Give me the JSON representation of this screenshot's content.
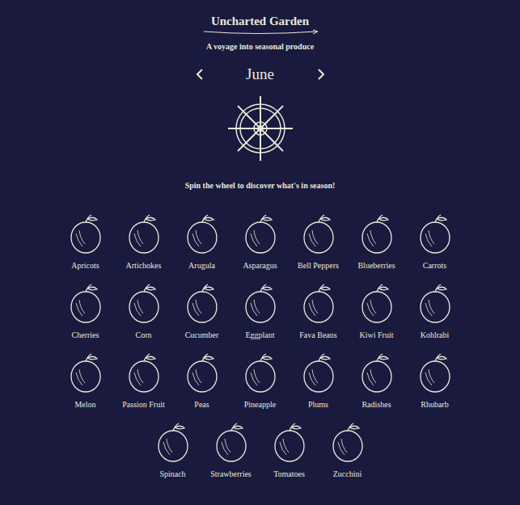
{
  "header": {
    "title": "Uncharted Garden",
    "tagline": "A voyage into seasonal produce"
  },
  "month_nav": {
    "month": "June"
  },
  "wheel": {
    "cue": "Spin the wheel to discover what's in season!"
  },
  "produce": [
    "Apricots",
    "Artichokes",
    "Arugula",
    "Asparagus",
    "Bell Peppers",
    "Blueberries",
    "Carrots",
    "Cherries",
    "Corn",
    "Cucumber",
    "Eggplant",
    "Fava Beans",
    "Kiwi Fruit",
    "Kohlrabi",
    "Melon",
    "Passion Fruit",
    "Peas",
    "Pineapple",
    "Plums",
    "Radishes",
    "Rhubarb",
    "Spinach",
    "Strawberries",
    "Tomatoes",
    "Zucchini"
  ]
}
